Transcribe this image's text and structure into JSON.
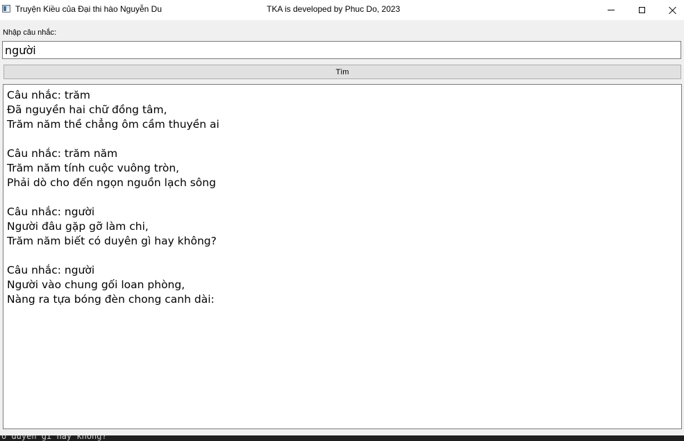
{
  "window": {
    "title": "Truyện Kiều của Đại thi hào Nguyễn Du",
    "center_title": "TKA is developed by Phuc Do, 2023",
    "controls": {
      "minimize_icon": "minimize-icon",
      "maximize_icon": "maximize-icon",
      "close_icon": "close-icon"
    }
  },
  "form": {
    "prompt_label": "Nhập câu nhắc:",
    "input_value": "người",
    "button_label": "Tìm"
  },
  "results": [
    {
      "prompt_line": "Câu nhắc: trăm",
      "verse1": "Đã nguyền hai chữ đồng tâm,",
      "verse2": "Trăm năm thề chẳng ôm cầm thuyền ai"
    },
    {
      "prompt_line": "Câu nhắc: trăm năm",
      "verse1": "Trăm năm tính cuộc vuông tròn,",
      "verse2": "Phải dò cho đến ngọn nguồn lạch sông"
    },
    {
      "prompt_line": "Câu nhắc: người",
      "verse1": "Người đâu gặp gỡ làm chi,",
      "verse2": "Trăm năm biết có duyên gì hay không?"
    },
    {
      "prompt_line": "Câu nhắc: người",
      "verse1": "Người vào chung gối loan phòng,",
      "verse2": "Nàng ra tựa bóng đèn chong canh dài:"
    }
  ],
  "terminal": {
    "text": "ó duyên gì hay không?"
  }
}
